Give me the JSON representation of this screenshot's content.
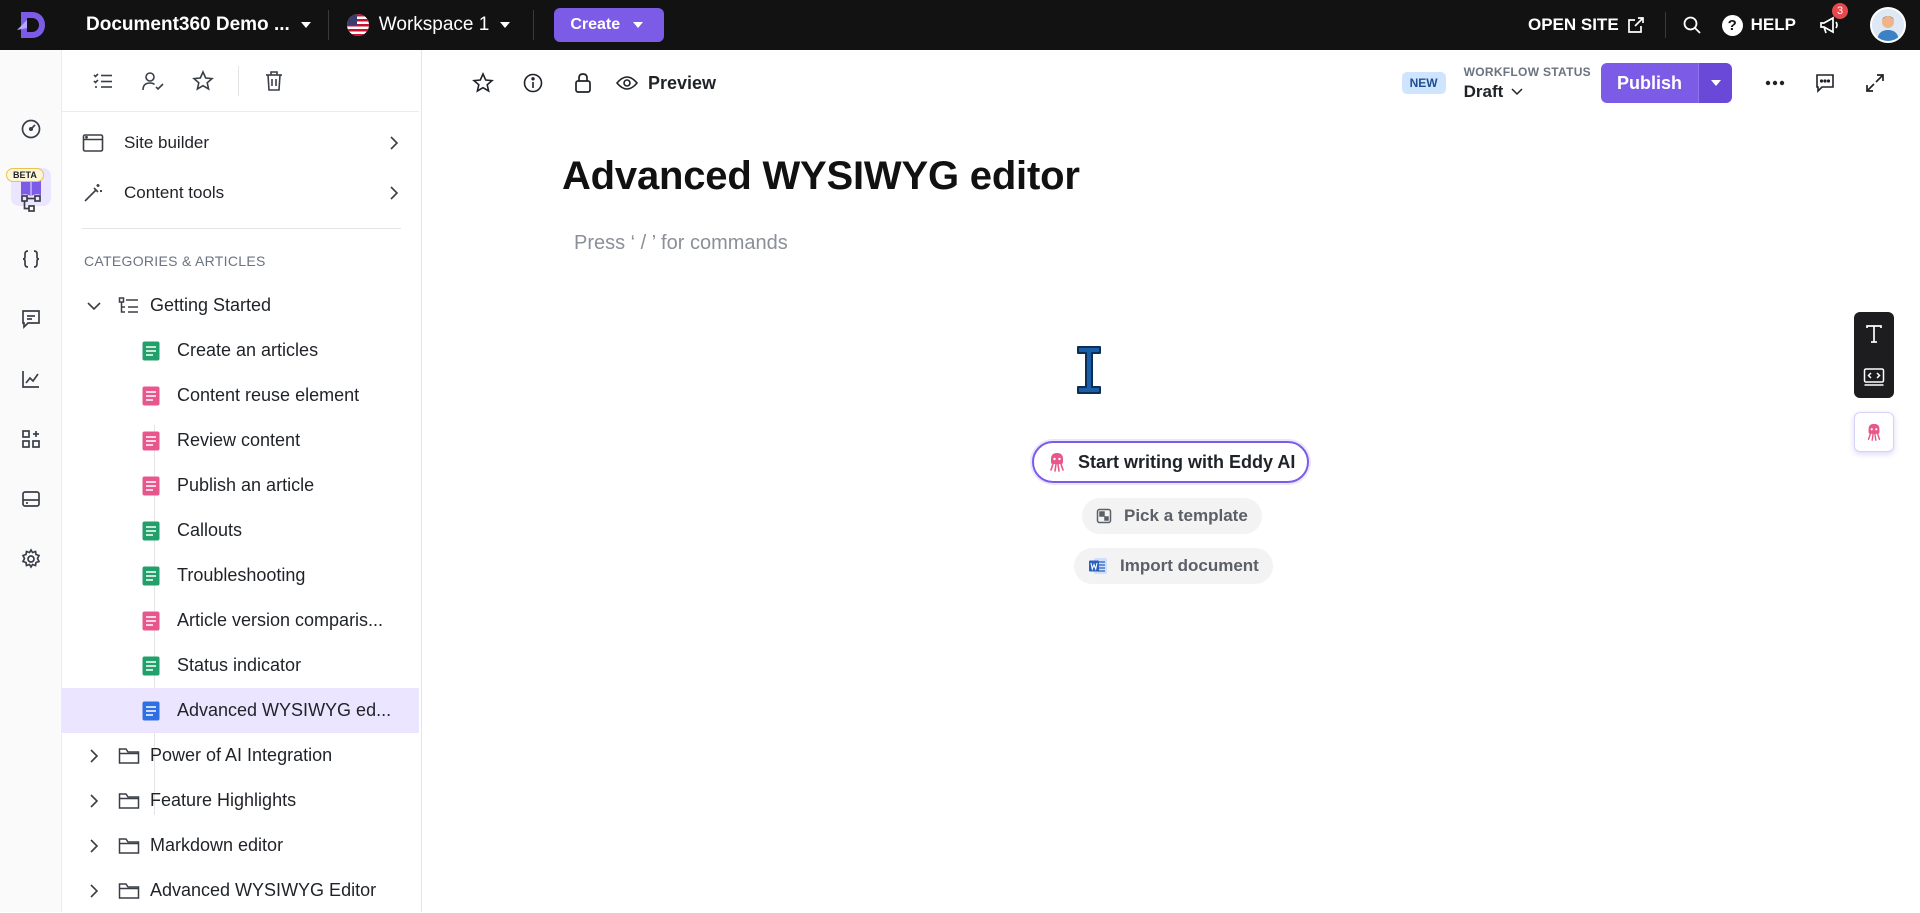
{
  "topbar": {
    "project_name": "Document360 Demo ...",
    "workspace": "Workspace 1",
    "create_label": "Create",
    "open_site_label": "OPEN SITE",
    "help_label": "HELP",
    "notification_count": "3"
  },
  "rail": {
    "beta_label": "BETA",
    "items": [
      "dashboard-icon",
      "documentation-icon",
      "api-docs-icon",
      "code-icon",
      "feedback-icon",
      "analytics-icon",
      "apps-icon",
      "widget-icon",
      "settings-icon"
    ]
  },
  "sidebar": {
    "menu": [
      {
        "label": "Site builder",
        "icon": "browser-window-icon"
      },
      {
        "label": "Content tools",
        "icon": "magic-wand-icon"
      }
    ],
    "section_title": "CATEGORIES & ARTICLES",
    "open_category": "Getting Started",
    "articles": [
      {
        "label": "Create an articles",
        "color": "#22a06b"
      },
      {
        "label": "Content reuse element",
        "color": "#e8578c"
      },
      {
        "label": "Review content",
        "color": "#e8578c"
      },
      {
        "label": "Publish an article",
        "color": "#e8578c"
      },
      {
        "label": "Callouts",
        "color": "#22a06b"
      },
      {
        "label": "Troubleshooting",
        "color": "#22a06b"
      },
      {
        "label": "Article version comparis...",
        "color": "#e8578c"
      },
      {
        "label": "Status indicator",
        "color": "#22a06b"
      },
      {
        "label": "Advanced WYSIWYG ed...",
        "color": "#2f6fe4"
      }
    ],
    "categories": [
      {
        "label": "Power of AI Integration"
      },
      {
        "label": "Feature Highlights"
      },
      {
        "label": "Markdown editor"
      },
      {
        "label": "Advanced WYSIWYG Editor"
      }
    ]
  },
  "editor": {
    "preview_label": "Preview",
    "new_badge": "NEW",
    "workflow_label": "WORKFLOW STATUS",
    "workflow_value": "Draft",
    "publish_label": "Publish",
    "title": "Advanced WYSIWYG editor",
    "placeholder": "Press ‘ / ’ for commands",
    "eddy_label": "Start writing with Eddy AI",
    "template_label": "Pick a template",
    "import_label": "Import document"
  },
  "colors": {
    "accent": "#7c5ce6",
    "topbar_bg": "#121212",
    "selected_bg": "#ebe5ff"
  }
}
